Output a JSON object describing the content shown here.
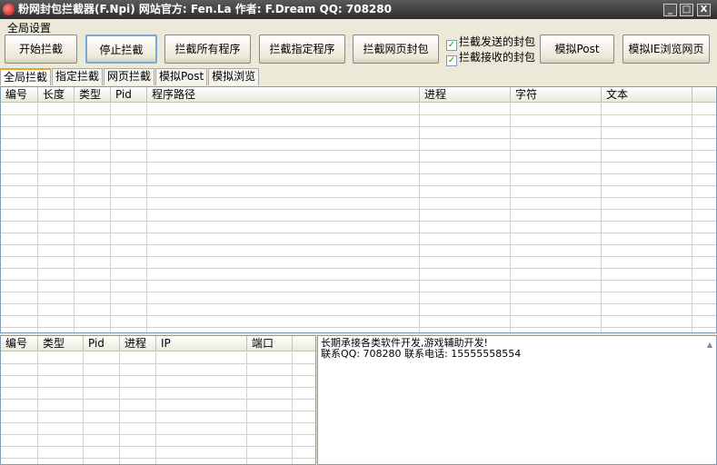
{
  "window": {
    "title": "粉网封包拦截器(F.Npi) 网站官方: Fen.La 作者: F.Dream QQ: 708280",
    "minimize": "_",
    "maximize": "□",
    "close": "X"
  },
  "group_label": "全局设置",
  "buttons": {
    "start": "开始拦截",
    "stop": "停止拦截",
    "all": "拦截所有程序",
    "specific": "拦截指定程序",
    "web": "拦截网页封包",
    "post": "模拟Post",
    "ie": "模拟IE浏览网页"
  },
  "checkboxes": [
    {
      "label": "拦截发送的封包",
      "checked": true
    },
    {
      "label": "拦截接收的封包",
      "checked": true
    }
  ],
  "check_mark": "✓",
  "tabs": [
    "全局拦截",
    "指定拦截",
    "网页拦截",
    "模拟Post",
    "模拟浏览"
  ],
  "main_table": {
    "columns": [
      "编号",
      "长度",
      "类型",
      "Pid",
      "程序路径",
      "进程",
      "字符",
      "文本"
    ]
  },
  "conn_table": {
    "columns": [
      "编号",
      "类型",
      "Pid",
      "进程",
      "IP",
      "端口"
    ]
  },
  "info_text": "长期承接各类软件开发,游戏辅助开发!\n联系QQ: 708280 联系电话: 15555558554"
}
